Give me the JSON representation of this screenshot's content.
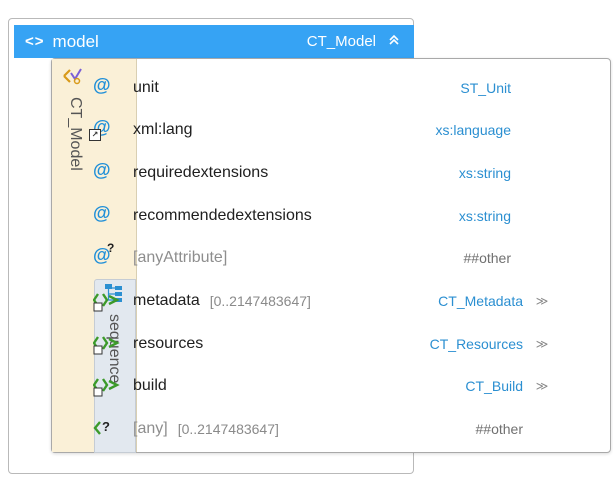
{
  "header": {
    "glyph": "<>",
    "name": "model",
    "type": "CT_Model",
    "collapse_glyph": "≈"
  },
  "complex_type": {
    "label": "CT_Model",
    "icon": "complex-type-icon"
  },
  "sequence": {
    "label": "sequence",
    "icon": "sequence-icon"
  },
  "attributes": [
    {
      "name": "unit",
      "type": "ST_Unit",
      "icon": "attribute-icon"
    },
    {
      "name": "xml:lang",
      "type": "xs:language",
      "icon": "attribute-reference-icon"
    },
    {
      "name": "requiredextensions",
      "type": "xs:string",
      "icon": "attribute-icon"
    },
    {
      "name": "recommendedextensions",
      "type": "xs:string",
      "icon": "attribute-icon"
    },
    {
      "name": "[anyAttribute]",
      "type": "##other",
      "icon": "any-attribute-icon"
    }
  ],
  "elements": [
    {
      "name": "metadata",
      "range": "[0..2147483647]",
      "type": "CT_Metadata",
      "icon": "element-reference-icon",
      "expand": "≫"
    },
    {
      "name": "resources",
      "range": "",
      "type": "CT_Resources",
      "icon": "element-reference-icon",
      "expand": "≫"
    },
    {
      "name": "build",
      "range": "",
      "type": "CT_Build",
      "icon": "element-reference-icon",
      "expand": "≫"
    },
    {
      "name": "[any]",
      "range": "[0..2147483647]",
      "type": "##other",
      "icon": "any-element-icon",
      "expand": ""
    }
  ],
  "colors": {
    "header_bg": "#36a3f4",
    "accent_blue": "#2b8fd1",
    "green": "#3c9a2a",
    "ct_strip": "#faf0d7",
    "seq_strip": "#e2e8ef"
  }
}
